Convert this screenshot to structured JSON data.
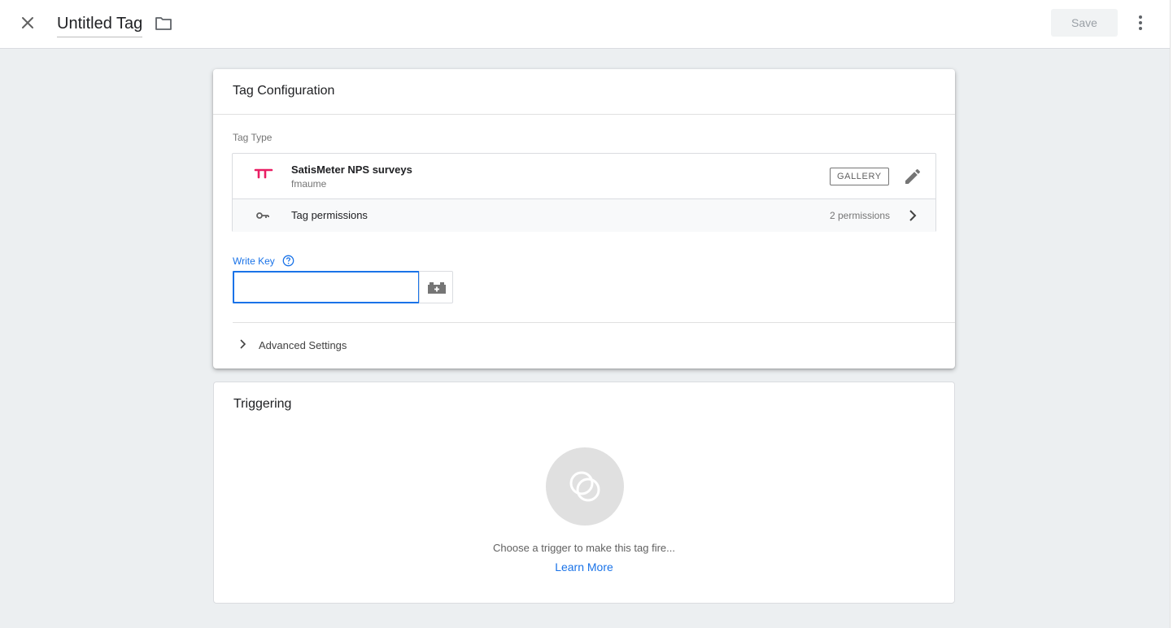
{
  "header": {
    "title": "Untitled Tag",
    "save_label": "Save"
  },
  "tag_configuration": {
    "heading": "Tag Configuration",
    "tag_type_label": "Tag Type",
    "tag_type": {
      "name": "SatisMeter NPS surveys",
      "author": "fmaume",
      "badge": "GALLERY",
      "logo_color": "#e91e63"
    },
    "permissions": {
      "label": "Tag permissions",
      "count": "2 permissions"
    },
    "write_key": {
      "label": "Write Key",
      "value": "",
      "placeholder": ""
    },
    "advanced_settings_label": "Advanced Settings"
  },
  "triggering": {
    "heading": "Triggering",
    "prompt": "Choose a trigger to make this tag fire...",
    "learn_more": "Learn More"
  },
  "colors": {
    "accent": "#1a73e8",
    "background": "#eceff1"
  }
}
